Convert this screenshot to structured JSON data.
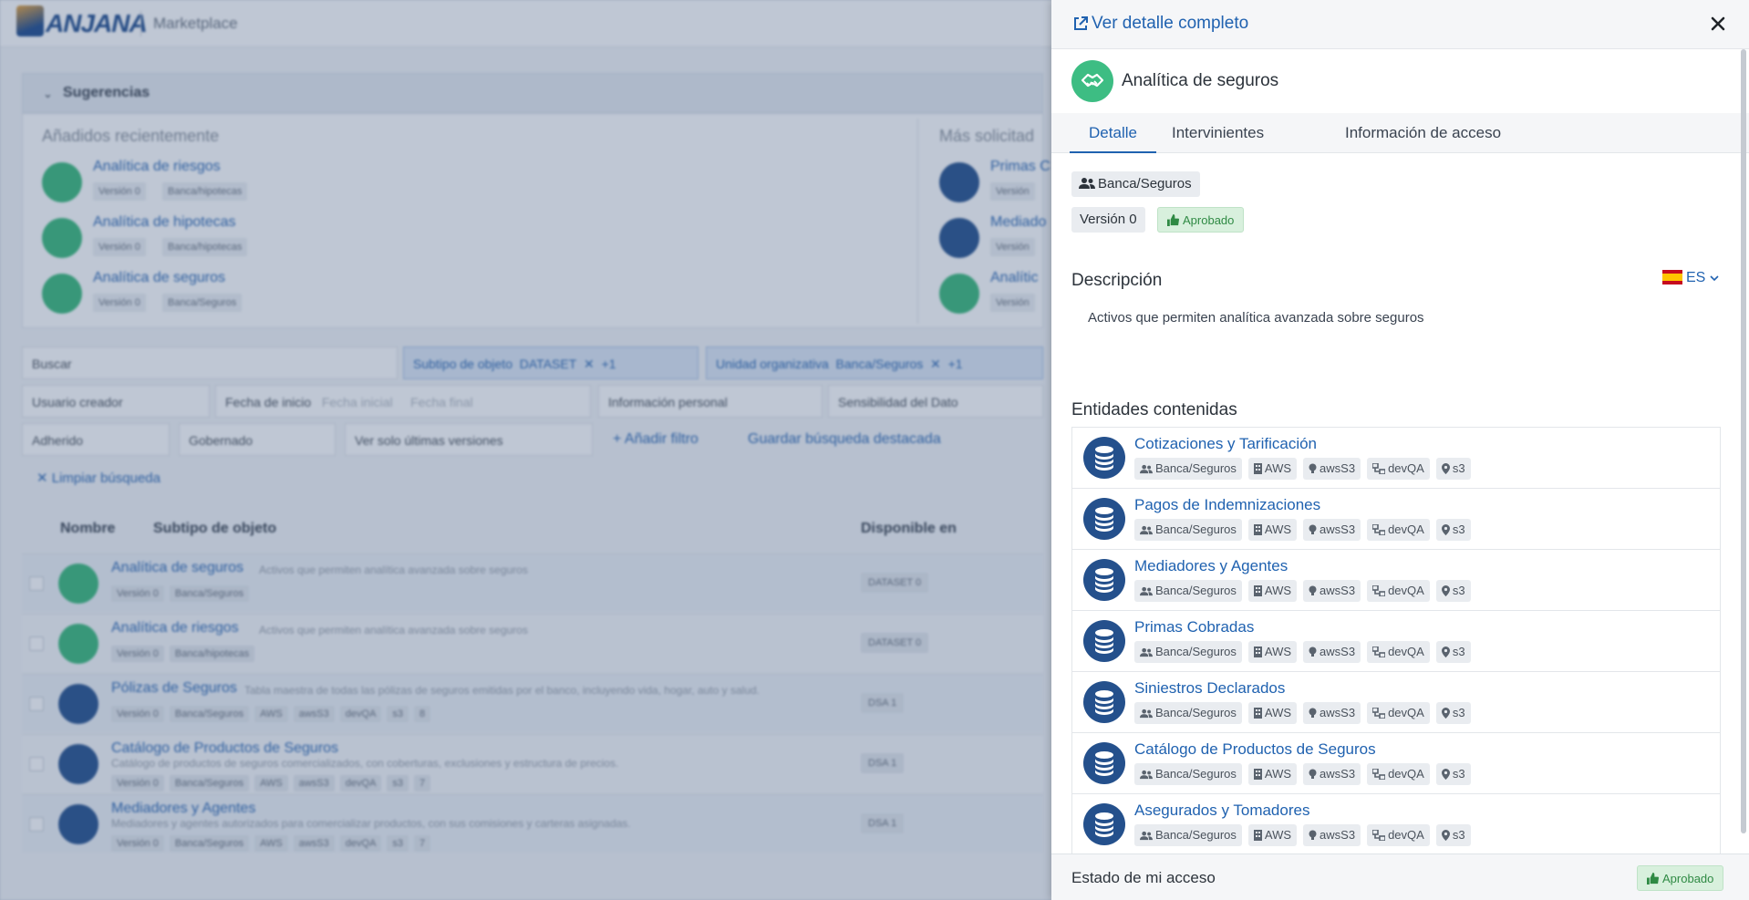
{
  "app": {
    "section": "Marketplace"
  },
  "background": {
    "suggestions_title": "Sugerencias",
    "recent_title": "Añadidos recientemente",
    "popular_title": "Más solicitad",
    "recent": [
      {
        "name": "Analítica de riesgos",
        "version": "Versión 0",
        "org": "Banca/hipotecas"
      },
      {
        "name": "Analítica de hipotecas",
        "version": "Versión 0",
        "org": "Banca/hipotecas"
      },
      {
        "name": "Analítica de seguros",
        "version": "Versión 0",
        "org": "Banca/Seguros"
      }
    ],
    "popular": [
      {
        "name": "Primas C",
        "version": "Versión"
      },
      {
        "name": "Mediado",
        "version": "Versión"
      },
      {
        "name": "Analític",
        "version": "Versión"
      }
    ],
    "filters": {
      "search": "Buscar",
      "subtype_label": "Subtipo de objeto",
      "subtype_value": "DATASET",
      "subtype_more": "+1",
      "org_label": "Unidad organizativa",
      "org_value": "Banca/Seguros",
      "org_more": "+1",
      "creator": "Usuario creador",
      "start_date": "Fecha de inicio",
      "initial_date": "Fecha inicial",
      "final_date": "Fecha final",
      "personal_info": "Información personal",
      "sensitivity": "Sensibilidad del Dato",
      "adhered": "Adherido",
      "governed": "Gobernado",
      "latest": "Ver solo últimas versiones",
      "add_filter": "+ Añadir filtro",
      "save_search": "Guardar búsqueda destacada",
      "clear": "✕ Limpiar búsqueda"
    },
    "table": {
      "col_name": "Nombre",
      "col_subtype": "Subtipo de objeto",
      "col_available": "Disponible en",
      "rows": [
        {
          "title": "Analítica de seguros",
          "desc": "Activos que permiten analítica avanzada sobre seguros",
          "tags": [
            "Versión 0",
            "Banca/Seguros"
          ],
          "avail": "DATASET 0",
          "icon": "green"
        },
        {
          "title": "Analítica de riesgos",
          "desc": "Activos que permiten analítica avanzada sobre seguros",
          "tags": [
            "Versión 0",
            "Banca/hipotecas"
          ],
          "avail": "DATASET 0",
          "icon": "green"
        },
        {
          "title": "Pólizas de Seguros",
          "desc": "Tabla maestra de todas las pólizas de seguros emitidas por el banco, incluyendo vida, hogar, auto y salud.",
          "tags": [
            "Versión 0",
            "Banca/Seguros",
            "AWS",
            "awsS3",
            "devQA",
            "s3",
            "8"
          ],
          "avail": "DSA 1",
          "icon": "blue"
        },
        {
          "title": "Catálogo de Productos de Seguros",
          "desc": "Catálogo de productos de seguros comercializados, con coberturas, exclusiones y estructura de precios.",
          "tags": [
            "Versión 0",
            "Banca/Seguros",
            "AWS",
            "awsS3",
            "devQA",
            "s3",
            "7"
          ],
          "avail": "DSA 1",
          "icon": "blue"
        },
        {
          "title": "Mediadores y Agentes",
          "desc": "Mediadores y agentes autorizados para comercializar productos, con sus comisiones y carteras asignadas.",
          "tags": [
            "Versión 0",
            "Banca/Seguros",
            "AWS",
            "awsS3",
            "devQA",
            "s3",
            "7"
          ],
          "avail": "DSA 1",
          "icon": "blue"
        }
      ]
    }
  },
  "drawer": {
    "full_detail_link": "Ver detalle completo",
    "title": "Analítica de seguros",
    "tabs": [
      "Detalle",
      "Intervinientes",
      "Información de acceso"
    ],
    "org": "Banca/Seguros",
    "version": "Versión 0",
    "status": "Aprobado",
    "description_heading": "Descripción",
    "language": "ES",
    "description": "Activos que permiten analítica avanzada sobre seguros",
    "entities_heading": "Entidades contenidas",
    "entities": [
      {
        "name": "Cotizaciones y Tarificación",
        "org": "Banca/Seguros",
        "provider": "AWS",
        "tech": "awsS3",
        "env": "devQA",
        "storage": "s3"
      },
      {
        "name": "Pagos de Indemnizaciones",
        "org": "Banca/Seguros",
        "provider": "AWS",
        "tech": "awsS3",
        "env": "devQA",
        "storage": "s3"
      },
      {
        "name": "Mediadores y Agentes",
        "org": "Banca/Seguros",
        "provider": "AWS",
        "tech": "awsS3",
        "env": "devQA",
        "storage": "s3"
      },
      {
        "name": "Primas Cobradas",
        "org": "Banca/Seguros",
        "provider": "AWS",
        "tech": "awsS3",
        "env": "devQA",
        "storage": "s3"
      },
      {
        "name": "Siniestros Declarados",
        "org": "Banca/Seguros",
        "provider": "AWS",
        "tech": "awsS3",
        "env": "devQA",
        "storage": "s3"
      },
      {
        "name": "Catálogo de Productos de Seguros",
        "org": "Banca/Seguros",
        "provider": "AWS",
        "tech": "awsS3",
        "env": "devQA",
        "storage": "s3"
      },
      {
        "name": "Asegurados y Tomadores",
        "org": "Banca/Seguros",
        "provider": "AWS",
        "tech": "awsS3",
        "env": "devQA",
        "storage": "s3"
      }
    ],
    "access_label": "Estado de mi acceso",
    "access_status": "Aprobado"
  },
  "colors": {
    "accent": "#2062b0",
    "success_bg": "#d8f0dd",
    "success_text": "#2f8a44",
    "green_icon": "#3dbd83",
    "db_icon": "#24508c"
  },
  "icons": [
    "external-link-icon",
    "close-icon",
    "handshake-icon",
    "users-icon",
    "thumbs-up-icon",
    "chevron-down-icon",
    "database-icon",
    "building-icon",
    "bulb-icon",
    "network-icon",
    "pin-icon"
  ]
}
